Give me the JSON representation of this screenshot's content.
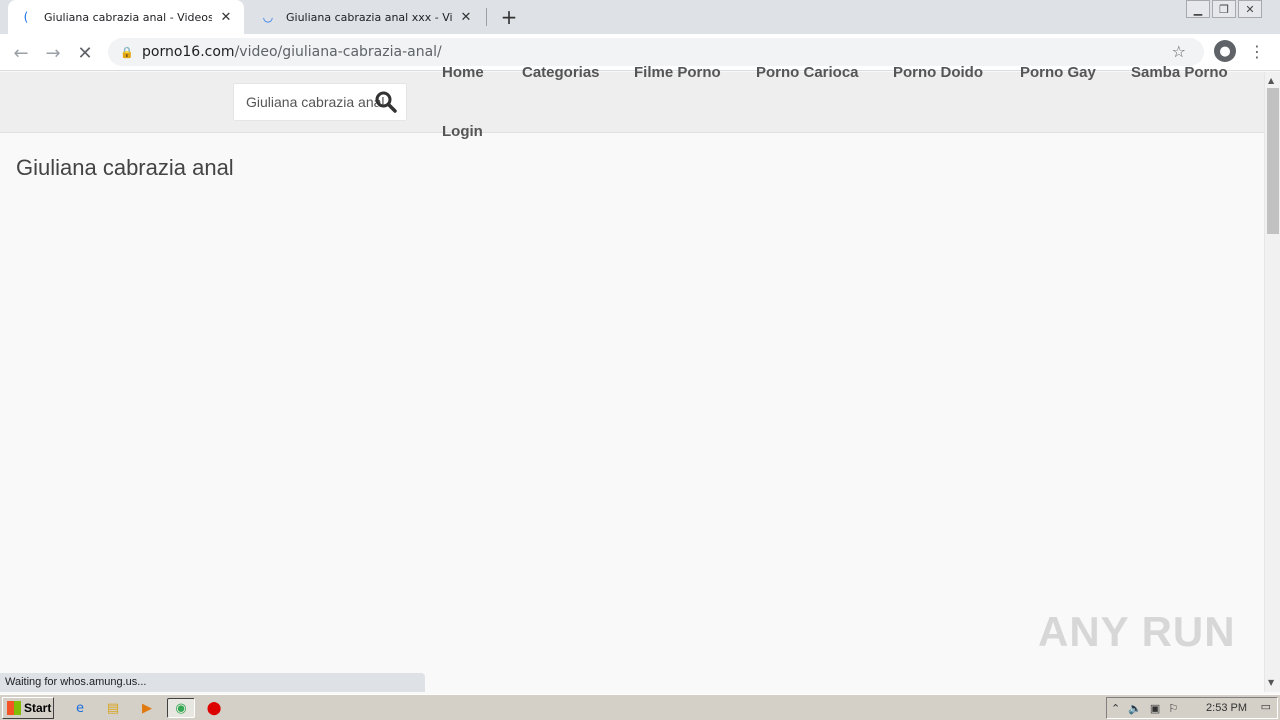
{
  "browser": {
    "tabs": [
      {
        "title": "Giuliana cabrazia anal - Videos Xxx |",
        "active": true
      },
      {
        "title": "Giuliana cabrazia anal xxx - Videos X",
        "active": false
      }
    ],
    "new_tab_icon": "plus-icon",
    "url_host": "porno16.com",
    "url_path": "/video/giuliana-cabrazia-anal/",
    "status_text": "Waiting for whos.amung.us..."
  },
  "site": {
    "search_value": "Giuliana cabrazia anal",
    "nav": [
      "Home",
      "Categorias",
      "Filme Porno",
      "Porno Carioca",
      "Porno Doido",
      "Porno Gay",
      "Samba Porno",
      "Login"
    ],
    "page_title": "Giuliana cabrazia anal"
  },
  "watermark": "ANY RUN",
  "taskbar": {
    "start_label": "Start",
    "clock": "2:53 PM"
  }
}
